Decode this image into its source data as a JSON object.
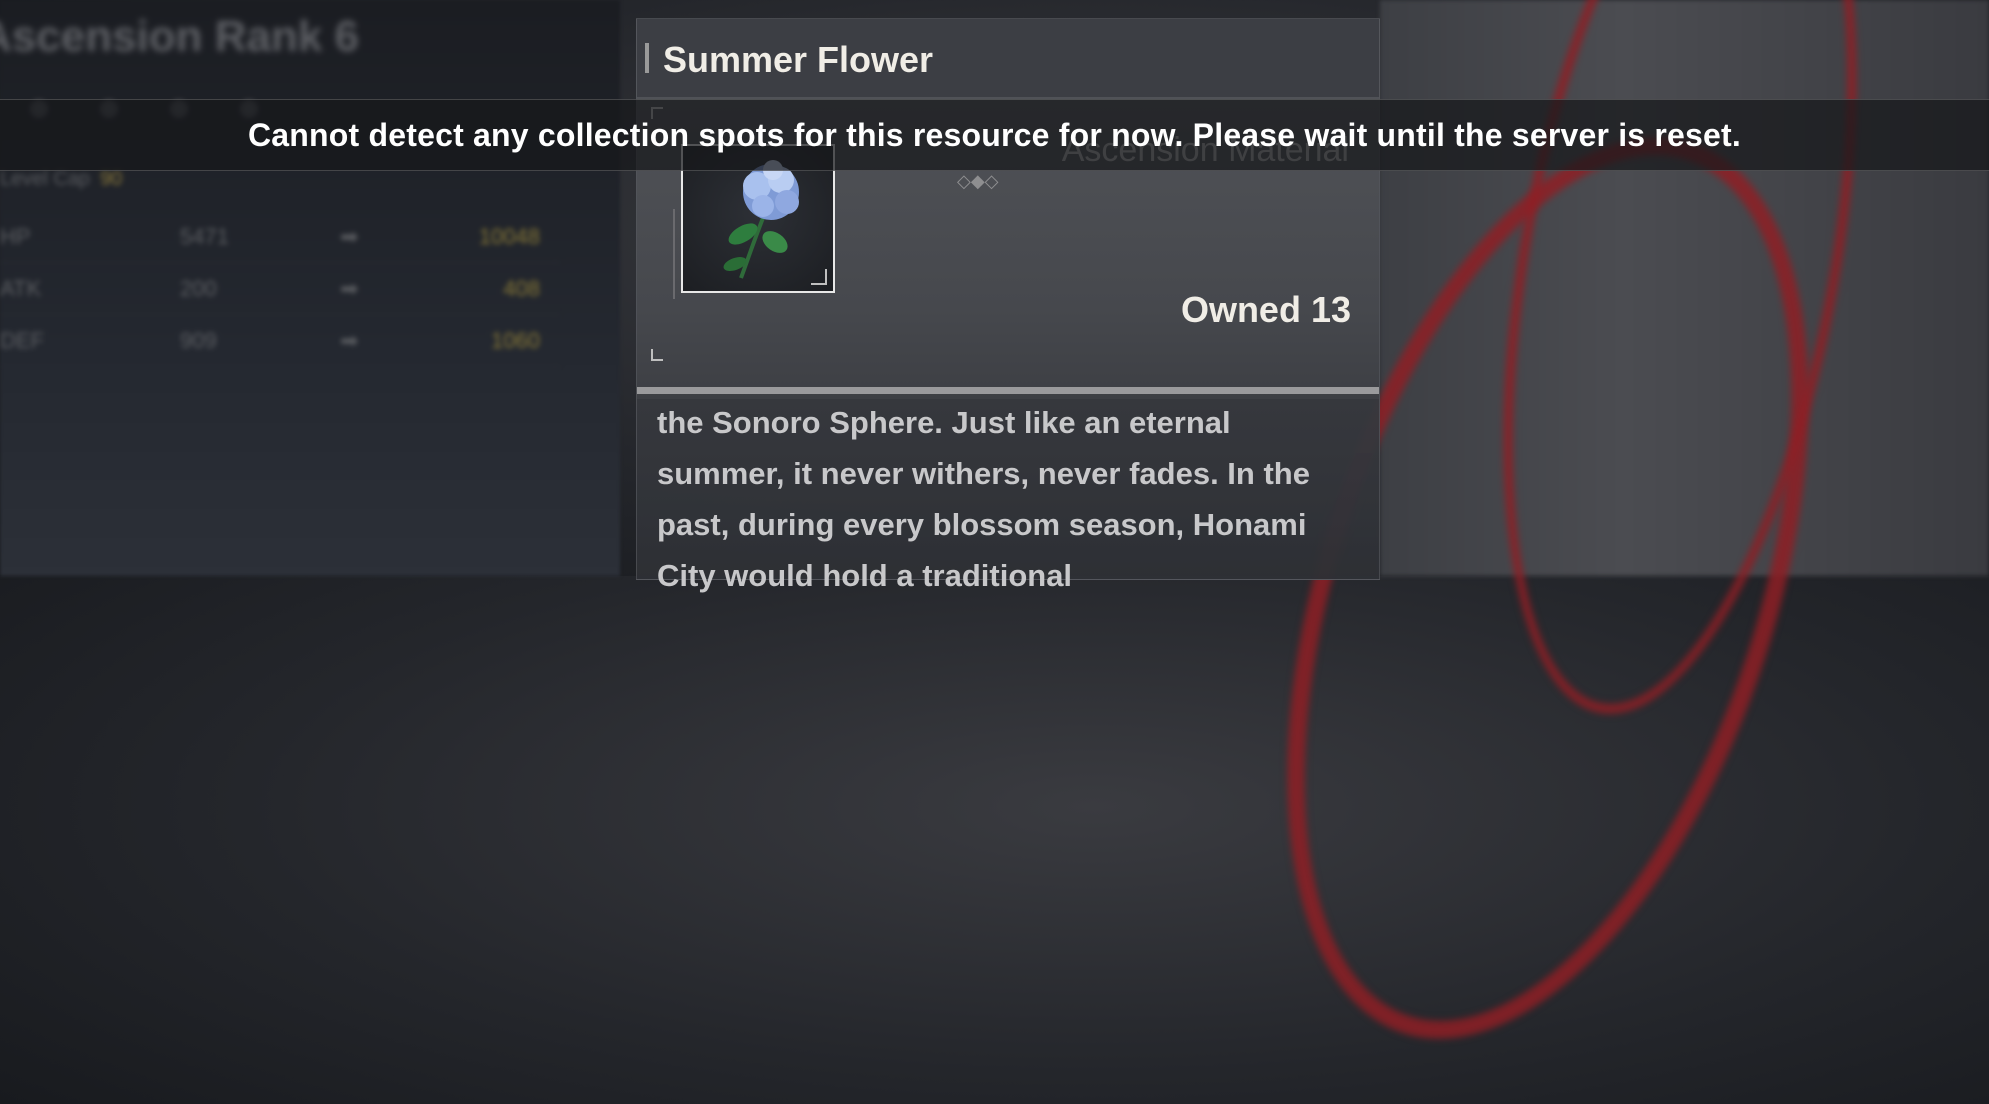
{
  "background": {
    "title": "Ascension Rank 6",
    "level_cap_label": "Level Cap",
    "level_cap_value": "90",
    "rows": [
      {
        "stat": "HP",
        "from": "5471",
        "to": "10048"
      },
      {
        "stat": "ATK",
        "from": "200",
        "to": "408"
      },
      {
        "stat": "DEF",
        "from": "909",
        "to": "1060"
      }
    ]
  },
  "item": {
    "name": "Summer Flower",
    "type": "Ascension Material",
    "owned_label": "Owned 13",
    "description": "the Sonoro Sphere. Just like an eternal summer, it never withers, never fades. In the past, during every blossom season, Honami City would hold a traditional"
  },
  "toast": {
    "message": "Cannot detect any collection spots for this resource for now. Please wait until the server is reset."
  }
}
